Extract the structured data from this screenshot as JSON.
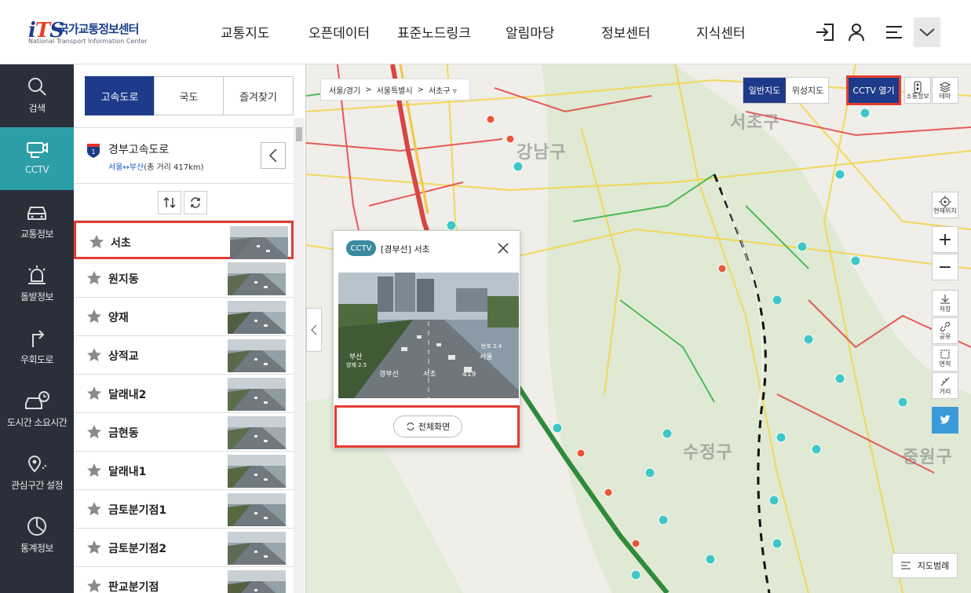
{
  "brand": {
    "mark": "iTS",
    "name_ko": "국가교통정보센터",
    "name_en": "National Transport Information Center"
  },
  "gnb": [
    "교통지도",
    "오픈데이터",
    "표준노드링크",
    "알림마당",
    "정보센터",
    "지식센터"
  ],
  "header_icons": [
    "login-icon",
    "user-icon",
    "menu-icon",
    "chevron-down-icon"
  ],
  "nav": [
    {
      "label": "검색",
      "icon": "search-icon",
      "active": false
    },
    {
      "label": "CCTV",
      "icon": "cctv-icon",
      "active": true
    },
    {
      "label": "교통정보",
      "icon": "car-icon",
      "active": false
    },
    {
      "label": "돌발정보",
      "icon": "alert-light-icon",
      "active": false
    },
    {
      "label": "우회도로",
      "icon": "detour-icon",
      "active": false
    },
    {
      "label": "도시간 소요시간",
      "icon": "travel-time-icon",
      "active": false
    },
    {
      "label": "관심구간 설정",
      "icon": "location-pin-icon",
      "active": false
    },
    {
      "label": "통계정보",
      "icon": "stats-icon",
      "active": false
    }
  ],
  "tabs": [
    "고속도로",
    "국도",
    "즐겨찾기"
  ],
  "road": {
    "number": "1",
    "name": "경부고속도로",
    "route": "서울↔부산",
    "length": "(총 거리 417km)"
  },
  "cctv_list": [
    {
      "name": "서초",
      "selected": true
    },
    {
      "name": "원지동",
      "selected": false
    },
    {
      "name": "양재",
      "selected": false
    },
    {
      "name": "상적교",
      "selected": false
    },
    {
      "name": "달래내2",
      "selected": false
    },
    {
      "name": "금현동",
      "selected": false
    },
    {
      "name": "달래내1",
      "selected": false
    },
    {
      "name": "금토분기점1",
      "selected": false
    },
    {
      "name": "금토분기점2",
      "selected": false
    },
    {
      "name": "판교분기점",
      "selected": false
    }
  ],
  "map": {
    "breadcrumb": [
      "서울/경기",
      ">",
      "서울특별시",
      ">",
      "서초구 ▿"
    ],
    "map_types": [
      "일반지도",
      "위성지도"
    ],
    "cctv_open": "CCTV 열기",
    "side_buttons": [
      "소통정보",
      "테마"
    ],
    "location_label": "현재위치",
    "zoom_in": "+",
    "zoom_out": "−",
    "tools": [
      "저장",
      "공유",
      "면적",
      "거리"
    ],
    "legend": "지도범례",
    "districts": [
      "서초구",
      "강남구",
      "수정구",
      "중원구"
    ]
  },
  "popup": {
    "tag": "CCTV",
    "title": "[경부선] 서초",
    "video_caption": [
      "부산",
      "양재 2.5",
      "경부선",
      "서초",
      "419",
      "반포 2.4",
      "서울"
    ],
    "fullscreen": "전체화면"
  },
  "colors": {
    "primary": "#1e3a8a",
    "accent": "#2c9ea8",
    "highlight": "#e53b2f",
    "nav_bg": "#2a2f3a"
  }
}
